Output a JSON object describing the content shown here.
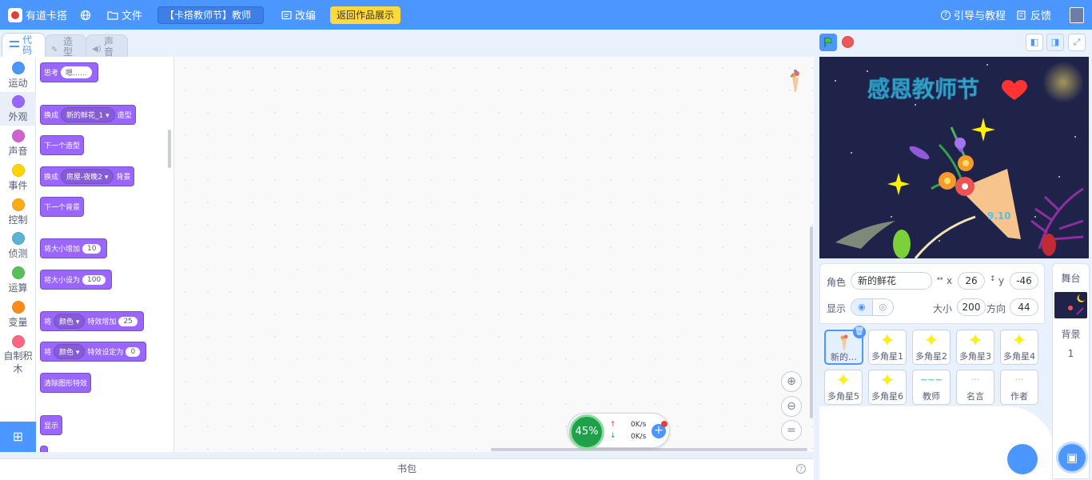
{
  "topbar": {
    "brand": "有道卡搭",
    "globe_icon": "globe-icon",
    "file_menu": "文件",
    "project_title": "【卡搭教师节】教师",
    "remix_label": "改编",
    "back_button": "返回作品展示",
    "guide_label": "引导与教程",
    "feedback_label": "反馈"
  },
  "editor_tabs": {
    "code": "代码",
    "costumes": "造型",
    "sounds": "声音"
  },
  "categories": [
    {
      "label": "运动",
      "color": "#4c97ff"
    },
    {
      "label": "外观",
      "color": "#9966ff"
    },
    {
      "label": "声音",
      "color": "#cf63cf"
    },
    {
      "label": "事件",
      "color": "#ffd500"
    },
    {
      "label": "控制",
      "color": "#ffab19"
    },
    {
      "label": "侦测",
      "color": "#5cb1d6"
    },
    {
      "label": "运算",
      "color": "#59c059"
    },
    {
      "label": "变量",
      "color": "#ff8c1a"
    },
    {
      "label": "自制积木",
      "color": "#ff6680"
    }
  ],
  "blocks": {
    "think_label": "思考",
    "think_value": "嗯……",
    "switch_costume_label": "换成",
    "switch_costume_value": "新的鲜花_1",
    "switch_costume_suffix": "造型",
    "next_costume": "下一个造型",
    "switch_backdrop_label": "换成",
    "switch_backdrop_value": "房屋-夜晚2",
    "switch_backdrop_suffix": "背景",
    "next_backdrop": "下一个背景",
    "change_size_label": "将大小增加",
    "change_size_value": "10",
    "set_size_label": "将大小设为",
    "set_size_value": "100",
    "change_effect_prefix": "将",
    "change_effect_drop": "颜色",
    "change_effect_label": "特效增加",
    "change_effect_value": "25",
    "set_effect_prefix": "将",
    "set_effect_drop": "颜色",
    "set_effect_label": "特效设定为",
    "set_effect_value": "0",
    "clear_effects": "清除图形特效",
    "show": "显示"
  },
  "perf": {
    "percent": "45%",
    "up_speed": "0K/s",
    "down_speed": "0K/s"
  },
  "backpack": {
    "label": "书包",
    "help": "?"
  },
  "stage": {
    "title": "感恩教师节",
    "date": "9.10"
  },
  "sprite_info": {
    "sprite_label": "角色",
    "sprite_name": "新的鲜花",
    "x_label": "x",
    "x_value": "26",
    "y_label": "y",
    "y_value": "-46",
    "show_label": "显示",
    "size_label": "大小",
    "size_value": "200",
    "direction_label": "方向",
    "direction_value": "44"
  },
  "sprites": [
    {
      "name": "新的…",
      "selected": true
    },
    {
      "name": "多角星1"
    },
    {
      "name": "多角星2"
    },
    {
      "name": "多角星3"
    },
    {
      "name": "多角星4"
    },
    {
      "name": "多角星5"
    },
    {
      "name": "多角星6"
    },
    {
      "name": "教师"
    },
    {
      "name": "名言"
    },
    {
      "name": "作者"
    }
  ],
  "stage_pane": {
    "title": "舞台",
    "backdrop_label": "背景",
    "backdrop_count": "1"
  }
}
